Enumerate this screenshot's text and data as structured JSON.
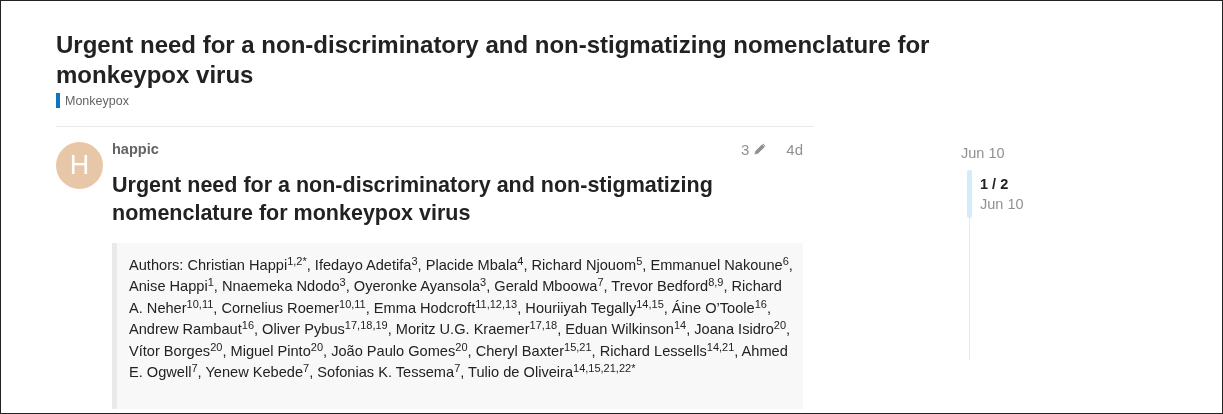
{
  "topic": {
    "title": "Urgent need for a non-discriminatory and non-stigmatizing nomenclature for monkeypox virus",
    "category": {
      "name": "Monkeypox",
      "color": "#0e76bd"
    }
  },
  "post": {
    "avatar_letter": "H",
    "username": "happic",
    "edits": "3",
    "age": "4d",
    "heading": "Urgent need for a non-discriminatory and non-stigmatizing nomenclature for monkeypox virus",
    "quote": "Authors: Christian Happi$^{1,2*}$, Ifedayo Adetifa$^{3}$, Placide Mbala$^{4}$, Richard Njouom$^{5}$, Emmanuel Nakoune$^{6}$, Anise Happi$^{1}$, Nnaemeka Ndodo$^{3}$, Oyeronke Ayansola$^{3}$, Gerald Mboowa$^{7}$, Trevor Bedford$^{8,9}$, Richard A. Neher$^{10,11}$, Cornelius Roemer$^{10,11}$, Emma Hodcroft$^{11,12,13}$, Houriiyah Tegally$^{14,15}$, Áine O’Toole$^{16}$, Andrew Rambaut$^{16}$, Oliver Pybus$^{17,18,19}$, Moritz U.G. Kraemer$^{17,18}$, Eduan Wilkinson$^{14}$, Joana Isidro$^{20}$, Vítor Borges$^{20}$, Miguel Pinto$^{20}$, João Paulo Gomes$^{20}$, Cheryl Baxter$^{15,21}$, Richard Lessells$^{14,21}$, Ahmed E. Ogwell$^{7}$, Yenew Kebede$^{7}$, Sofonias K. Tessema$^{7}$, Tulio de Oliveira$^{14,15,21,22*}$"
  },
  "timeline": {
    "start_date": "Jun 10",
    "position": "1 / 2",
    "current_date": "Jun 10"
  }
}
